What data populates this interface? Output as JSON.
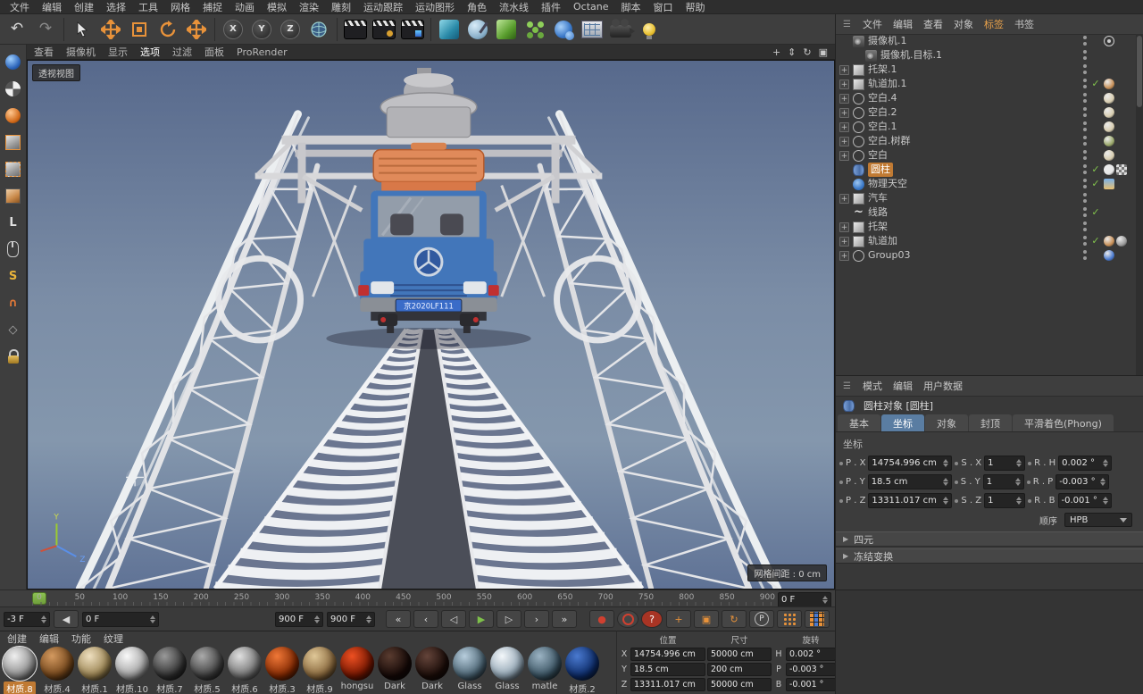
{
  "menubar": {
    "items": [
      "文件",
      "编辑",
      "创建",
      "选择",
      "工具",
      "网格",
      "捕捉",
      "动画",
      "模拟",
      "渲染",
      "雕刻",
      "运动跟踪",
      "运动图形",
      "角色",
      "流水线",
      "插件",
      "Octane",
      "脚本",
      "窗口",
      "帮助"
    ]
  },
  "toolbar": {
    "buttons": [
      {
        "name": "undo-button",
        "kind": "glyph",
        "glyph": "↶",
        "color": "#d8d8d8"
      },
      {
        "name": "redo-button",
        "kind": "glyph",
        "glyph": "↷",
        "color": "#8a8a8a"
      },
      {
        "name": "toolbar-separator",
        "kind": "sep"
      },
      {
        "name": "live-selection-button",
        "kind": "cursor"
      },
      {
        "name": "move-tool-button",
        "kind": "move"
      },
      {
        "name": "scale-tool-button",
        "kind": "scale"
      },
      {
        "name": "rotate-tool-button",
        "kind": "rotate"
      },
      {
        "name": "last-tool-button",
        "kind": "move"
      },
      {
        "name": "toolbar-separator",
        "kind": "sep"
      },
      {
        "name": "lock-x-axis-button",
        "kind": "axis",
        "glyph": "X"
      },
      {
        "name": "lock-y-axis-button",
        "kind": "axis",
        "glyph": "Y"
      },
      {
        "name": "lock-z-axis-button",
        "kind": "axis",
        "glyph": "Z"
      },
      {
        "name": "coordinate-system-button",
        "kind": "globe"
      },
      {
        "name": "toolbar-separator",
        "kind": "sep"
      },
      {
        "name": "render-view-button",
        "kind": "clapper"
      },
      {
        "name": "render-settings-button",
        "kind": "clapper2"
      },
      {
        "name": "edit-render-settings-button",
        "kind": "clapper3"
      },
      {
        "name": "toolbar-separator",
        "kind": "sep"
      },
      {
        "name": "subdivision-surface-button",
        "kind": "cube-teal"
      },
      {
        "name": "pen-tool-button",
        "kind": "pen"
      },
      {
        "name": "generator-button",
        "kind": "cube-green"
      },
      {
        "name": "cloner-button",
        "kind": "cloner"
      },
      {
        "name": "metaball-button",
        "kind": "metaball"
      },
      {
        "name": "array-button",
        "kind": "array"
      },
      {
        "name": "camera-button",
        "kind": "cam"
      },
      {
        "name": "light-button",
        "kind": "bulb"
      }
    ]
  },
  "leftbar": {
    "items": [
      {
        "name": "convert-object-icon",
        "kind": "sphere-blue"
      },
      {
        "name": "model-mode-icon",
        "kind": "checker-ball"
      },
      {
        "name": "texture-mode-icon",
        "kind": "sphere-orange"
      },
      {
        "name": "points-mode-icon",
        "kind": "cube-pts"
      },
      {
        "name": "edges-mode-icon",
        "kind": "cube-edg"
      },
      {
        "name": "polygons-mode-icon",
        "kind": "cube-pol"
      },
      {
        "name": "workplane-icon",
        "kind": "glyph",
        "glyph": "L",
        "color": "#e0e0e0"
      },
      {
        "name": "viewport-solo-icon",
        "kind": "mouse"
      },
      {
        "name": "snap-icon",
        "kind": "glyph",
        "glyph": "S",
        "color": "#e8b33a"
      },
      {
        "name": "magnet-icon",
        "kind": "glyph",
        "glyph": "∩",
        "color": "#e07838"
      },
      {
        "name": "plane-icon",
        "kind": "glyph",
        "glyph": "◇",
        "color": "#aaaaaa"
      },
      {
        "name": "lock-icon",
        "kind": "lock"
      }
    ]
  },
  "viewport": {
    "menu": [
      {
        "label": "查看"
      },
      {
        "label": "摄像机"
      },
      {
        "label": "显示"
      },
      {
        "label": "选项",
        "active": true
      },
      {
        "label": "过滤"
      },
      {
        "label": "面板"
      },
      {
        "label": "ProRender"
      }
    ],
    "nav_icons": [
      {
        "name": "pan-view-icon",
        "glyph": "+"
      },
      {
        "name": "zoom-view-icon",
        "glyph": "⇕"
      },
      {
        "name": "rotate-view-icon",
        "glyph": "↻"
      },
      {
        "name": "toggle-view-icon",
        "glyph": "▣"
      }
    ],
    "view_label": "透视视图",
    "grid_info": "网格间距 : 0 cm",
    "truck_plate": "京2020LF111",
    "axis": {
      "y": "Y",
      "z": "Z"
    }
  },
  "object_manager": {
    "menus": [
      "文件",
      "编辑",
      "查看",
      "对象",
      "标签",
      "书签"
    ],
    "highlight_menu": "标签",
    "items": [
      {
        "label": "摄像机.1",
        "icon": "camera",
        "tags": [
          {
            "type": "target"
          }
        ]
      },
      {
        "label": "摄像机.目标.1",
        "icon": "camera",
        "indent": 1
      },
      {
        "label": "托架.1",
        "icon": "cube",
        "expander": true
      },
      {
        "label": "轨道加.1",
        "icon": "cube",
        "expander": true,
        "check": true,
        "tags": [
          {
            "type": "sphere",
            "color": "#c89058"
          }
        ]
      },
      {
        "label": "空白.4",
        "icon": "null",
        "expander": true,
        "tags": [
          {
            "type": "sphere",
            "color": "#d8cdb0"
          }
        ]
      },
      {
        "label": "空白.2",
        "icon": "null",
        "expander": true,
        "tags": [
          {
            "type": "sphere",
            "color": "#d8cdb0"
          }
        ]
      },
      {
        "label": "空白.1",
        "icon": "null",
        "expander": true,
        "tags": [
          {
            "type": "sphere",
            "color": "#d8cdb0"
          }
        ]
      },
      {
        "label": "空白.树群",
        "icon": "null",
        "expander": true,
        "tags": [
          {
            "type": "sphere",
            "color": "#9aa86a"
          }
        ]
      },
      {
        "label": "空白",
        "icon": "null",
        "expander": true,
        "tags": [
          {
            "type": "sphere",
            "color": "#d8cdb0"
          }
        ]
      },
      {
        "label": "圆柱",
        "icon": "cylinder",
        "selected": true,
        "check": true,
        "tags": [
          {
            "type": "sphere",
            "color": "#e8e8e8"
          },
          {
            "type": "checker"
          }
        ]
      },
      {
        "label": "物理天空",
        "icon": "sky",
        "check": true,
        "tags": [
          {
            "type": "sky"
          }
        ]
      },
      {
        "label": "汽车",
        "icon": "cube",
        "expander": true
      },
      {
        "label": "线路",
        "icon": "spline",
        "check": true
      },
      {
        "label": "托架",
        "icon": "cube",
        "expander": true
      },
      {
        "label": "轨道加",
        "icon": "cube",
        "expander": true,
        "check": true,
        "tags": [
          {
            "type": "sphere",
            "color": "#c89058"
          },
          {
            "type": "sphere",
            "color": "#9a9a9a"
          }
        ]
      },
      {
        "label": "Group03",
        "icon": "null",
        "expander": true,
        "tags": [
          {
            "type": "sphere",
            "color": "#4a7ad0"
          }
        ]
      }
    ]
  },
  "attribute_manager": {
    "menus": [
      "模式",
      "编辑",
      "用户数据"
    ],
    "title": "圆柱对象 [圆柱]",
    "tabs": [
      {
        "label": "基本"
      },
      {
        "label": "坐标",
        "active": true
      },
      {
        "label": "对象"
      },
      {
        "label": "封顶"
      },
      {
        "label": "平滑着色(Phong)"
      }
    ],
    "section_label": "坐标",
    "rows": [
      {
        "p_label": "P . X",
        "p": "14754.996 cm",
        "s_label": "S . X",
        "s": "1",
        "r_label": "R . H",
        "r": "0.002 °"
      },
      {
        "p_label": "P . Y",
        "p": "18.5 cm",
        "s_label": "S . Y",
        "s": "1",
        "r_label": "R . P",
        "r": "-0.003 °"
      },
      {
        "p_label": "P . Z",
        "p": "13311.017 cm",
        "s_label": "S . Z",
        "s": "1",
        "r_label": "R . B",
        "r": "-0.001 °"
      }
    ],
    "order_label": "顺序",
    "order_value": "HPB",
    "sections": [
      "四元",
      "冻结变换"
    ]
  },
  "timeline": {
    "labels": [
      "0",
      "50",
      "100",
      "150",
      "200",
      "250",
      "300",
      "350",
      "400",
      "450",
      "500",
      "550",
      "600",
      "650",
      "700",
      "750",
      "800",
      "850",
      "900"
    ],
    "right_field": "0 F"
  },
  "transport": {
    "frame_start": "-3 F",
    "frame_current": "0 F",
    "frame_end": "900 F",
    "frame_total": "900 F",
    "play_buttons": [
      {
        "name": "goto-start-button",
        "glyph": "«"
      },
      {
        "name": "prev-key-button",
        "glyph": "‹"
      },
      {
        "name": "prev-frame-button",
        "glyph": "◁"
      },
      {
        "name": "play-button",
        "glyph": "▶",
        "color": "#7ec04a"
      },
      {
        "name": "next-frame-button",
        "glyph": "▷"
      },
      {
        "name": "next-key-button",
        "glyph": "›"
      },
      {
        "name": "goto-end-button",
        "glyph": "»"
      }
    ],
    "record_buttons": [
      {
        "name": "record-keyframe-button",
        "glyph": "●",
        "color": "#d04030"
      },
      {
        "name": "autokey-button",
        "kind": "ring"
      },
      {
        "name": "keyframe-help-button",
        "glyph": "?",
        "bg": "#a83424",
        "color": "#fff"
      }
    ],
    "lock_buttons": [
      {
        "name": "record-position-button",
        "glyph": "+",
        "color": "#e8923a"
      },
      {
        "name": "record-scale-button",
        "glyph": "▣",
        "color": "#e8923a"
      },
      {
        "name": "record-rotation-button",
        "glyph": "↻",
        "color": "#e8923a"
      },
      {
        "name": "record-parameter-button",
        "kind": "pcircle",
        "glyph": "P"
      },
      {
        "name": "record-pla-button",
        "kind": "dotgrid"
      },
      {
        "name": "keyframe-selection-button",
        "kind": "colorgrid"
      }
    ]
  },
  "material_manager": {
    "menus": [
      "创建",
      "编辑",
      "功能",
      "纹理"
    ],
    "materials": [
      {
        "name": "材质.8",
        "c1": "#f0f0f0",
        "c2": "#8a8a8a",
        "selected": true
      },
      {
        "name": "材质.4",
        "c1": "#d49a60",
        "c2": "#6e4218"
      },
      {
        "name": "材质.1",
        "c1": "#efe0c0",
        "c2": "#97804e"
      },
      {
        "name": "材质.10",
        "c1": "#fafafa",
        "c2": "#9f9f9f"
      },
      {
        "name": "材质.7",
        "c1": "#9a9a9a",
        "c2": "#2e2e2e"
      },
      {
        "name": "材质.5",
        "c1": "#ababab",
        "c2": "#3c3c3c"
      },
      {
        "name": "材质.6",
        "c1": "#e0e0e0",
        "c2": "#6f6f6f"
      },
      {
        "name": "材质.3",
        "c1": "#f07838",
        "c2": "#7e2600"
      },
      {
        "name": "材质.9",
        "c1": "#e0c898",
        "c2": "#86653a"
      },
      {
        "name": "hongsu",
        "c1": "#ee5022",
        "c2": "#6e1400"
      },
      {
        "name": "Dark",
        "c1": "#5a3c30",
        "c2": "#140806"
      },
      {
        "name": "Dark",
        "c1": "#64443a",
        "c2": "#1a0c08"
      },
      {
        "name": "Glass",
        "c1": "#b8cedd",
        "c2": "#47606f"
      },
      {
        "name": "Glass",
        "c1": "#f4f8fb",
        "c2": "#8fa3b2"
      },
      {
        "name": "matle",
        "c1": "#9cb4c4",
        "c2": "#37505f"
      },
      {
        "name": "材质.2",
        "c1": "#4a7ad0",
        "c2": "#0c2a66"
      }
    ]
  },
  "coordinate_manager": {
    "headers": [
      "位置",
      "尺寸",
      "旋转"
    ],
    "rows": [
      {
        "axis": "X",
        "pos": "14754.996 cm",
        "size": "50000 cm",
        "rot_label": "H",
        "rot": "0.002 °"
      },
      {
        "axis": "Y",
        "pos": "18.5 cm",
        "size": "200 cm",
        "rot_label": "P",
        "rot": "-0.003 °"
      },
      {
        "axis": "Z",
        "pos": "13311.017 cm",
        "size": "50000 cm",
        "rot_label": "B",
        "rot": "-0.001 °"
      }
    ]
  },
  "colors": {
    "accent_orange": "#e8923a",
    "selection_orange": "#c07a33",
    "active_tab_blue": "#5a7da2",
    "play_green": "#7ec04a",
    "sky_top": "#5b6d8e"
  }
}
